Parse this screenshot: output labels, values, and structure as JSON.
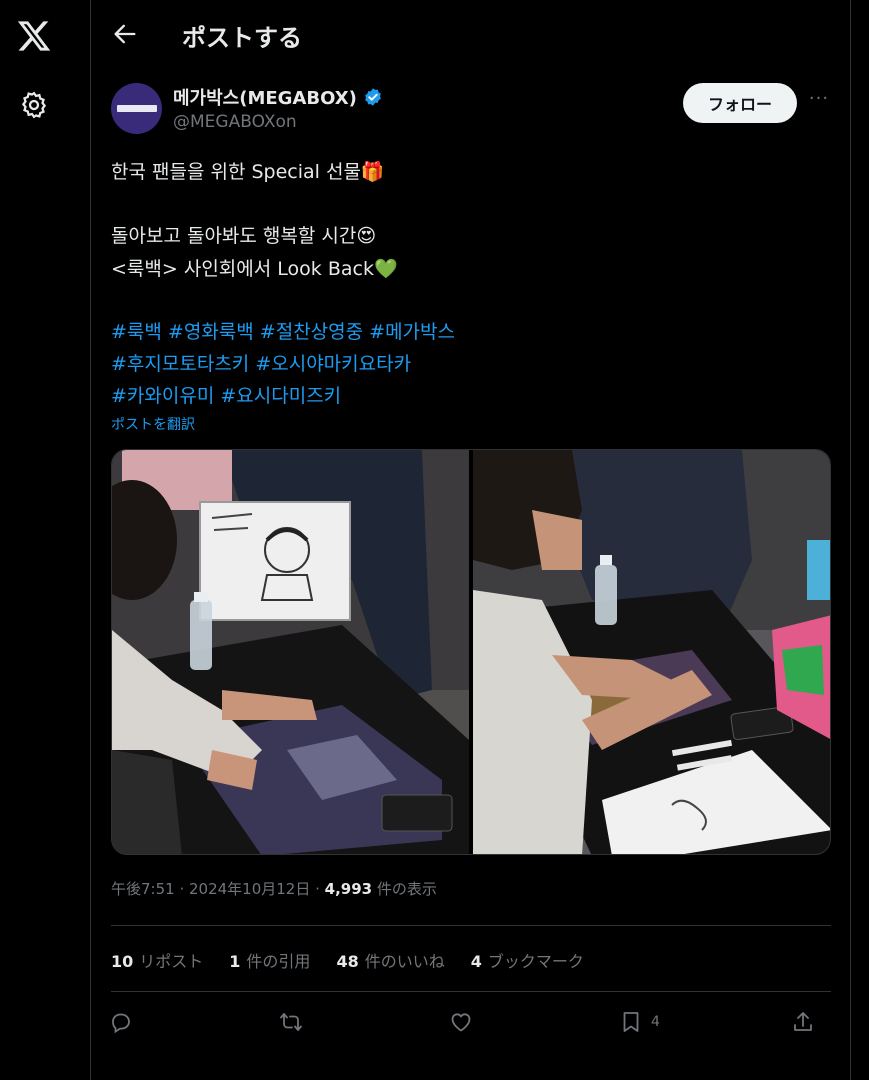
{
  "header": {
    "title": "ポストする"
  },
  "post": {
    "author_name": "메가박스(MEGABOX)",
    "handle": "@MEGABOXon",
    "follow_label": "フォロー",
    "more_label": "···",
    "lines": [
      "한국 팬들을 위한 Special 선물🎁",
      "돌아보고 돌아봐도 행복할 시간😍",
      "<룩백> 사인회에서 Look Back💚"
    ],
    "hashtag_lines": [
      "#룩백 #영화룩백 #절찬상영중 #메가박스",
      "#후지모토타츠키 #오시야마키요타카",
      "#카와이유미 #요시다미즈키"
    ],
    "translate_label": "ポストを翻訳",
    "time": "午後7:51",
    "date": "2024年10月12日",
    "views_count": "4,993",
    "views_label": "件の表示",
    "separator": " · "
  },
  "stats": {
    "reposts_count": "10",
    "reposts_label": "リポスト",
    "quotes_count": "1",
    "quotes_label": "件の引用",
    "likes_count": "48",
    "likes_label": "件のいいね",
    "bookmarks_count": "4",
    "bookmarks_label": "ブックマーク"
  },
  "actions": {
    "bookmark_count": "4"
  },
  "icons": {
    "logo": "x-logo-icon",
    "settings": "gear-icon",
    "back": "arrow-left-icon",
    "verified": "verified-badge-icon",
    "reply": "reply-icon",
    "repost": "repost-icon",
    "like": "heart-icon",
    "bookmark": "bookmark-icon",
    "share": "share-icon"
  },
  "colors": {
    "accent": "#1d9bf0",
    "background": "#000000",
    "muted": "#71767b",
    "text": "#e7e9ea"
  }
}
